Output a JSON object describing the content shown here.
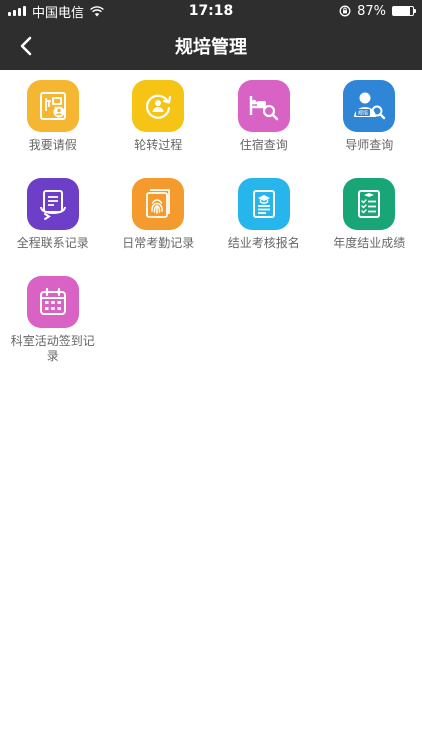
{
  "status_bar": {
    "carrier": "中国电信",
    "time": "17:18",
    "battery_percent": "87%",
    "battery_level": 0.87
  },
  "nav": {
    "title": "规培管理"
  },
  "menu": [
    {
      "label": "我要请假",
      "icon": "leave-request-icon",
      "color": "#f5b731"
    },
    {
      "label": "轮转过程",
      "icon": "rotation-cycle-icon",
      "color": "#f6c415"
    },
    {
      "label": "住宿查询",
      "icon": "bed-search-icon",
      "color": "#d863c4"
    },
    {
      "label": "导师查询",
      "icon": "mentor-search-icon",
      "color": "#2f86d6"
    },
    {
      "label": "全程联系记录",
      "icon": "contact-record-icon",
      "color": "#6d3fc9"
    },
    {
      "label": "日常考勤记录",
      "icon": "fingerprint-icon",
      "color": "#f59a2c"
    },
    {
      "label": "结业考核报名",
      "icon": "graduation-exam-icon",
      "color": "#27b6ec"
    },
    {
      "label": "年度结业成绩",
      "icon": "checklist-grade-icon",
      "color": "#19a676"
    },
    {
      "label": "科室活动签到记录",
      "icon": "calendar-icon",
      "color": "#d863c4"
    }
  ],
  "mentor_badge": "规培"
}
